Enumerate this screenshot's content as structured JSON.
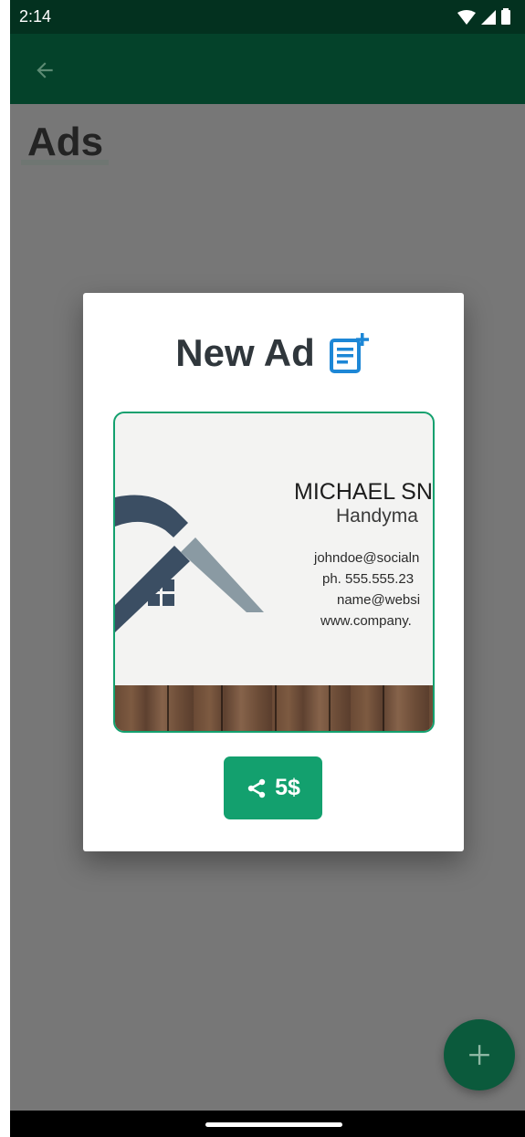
{
  "status_bar": {
    "time": "2:14"
  },
  "page": {
    "title": "Ads"
  },
  "dialog": {
    "title": "New Ad",
    "card": {
      "name": "MICHAEL SN",
      "role": "Handyma",
      "email": "johndoe@socialn",
      "phone": "ph. 555.555.23",
      "email2": "name@websi",
      "website": "www.company."
    },
    "share_button": {
      "label": "5$"
    }
  },
  "colors": {
    "accent": "#13a06e",
    "appbar": "#04422a",
    "statusbar": "#03311f",
    "scrim": "#777777",
    "fab": "#0b5a3c"
  },
  "icons": {
    "back": "arrow-left-icon",
    "new_ad": "note-add-icon",
    "share": "share-icon",
    "fab": "plus-icon"
  }
}
